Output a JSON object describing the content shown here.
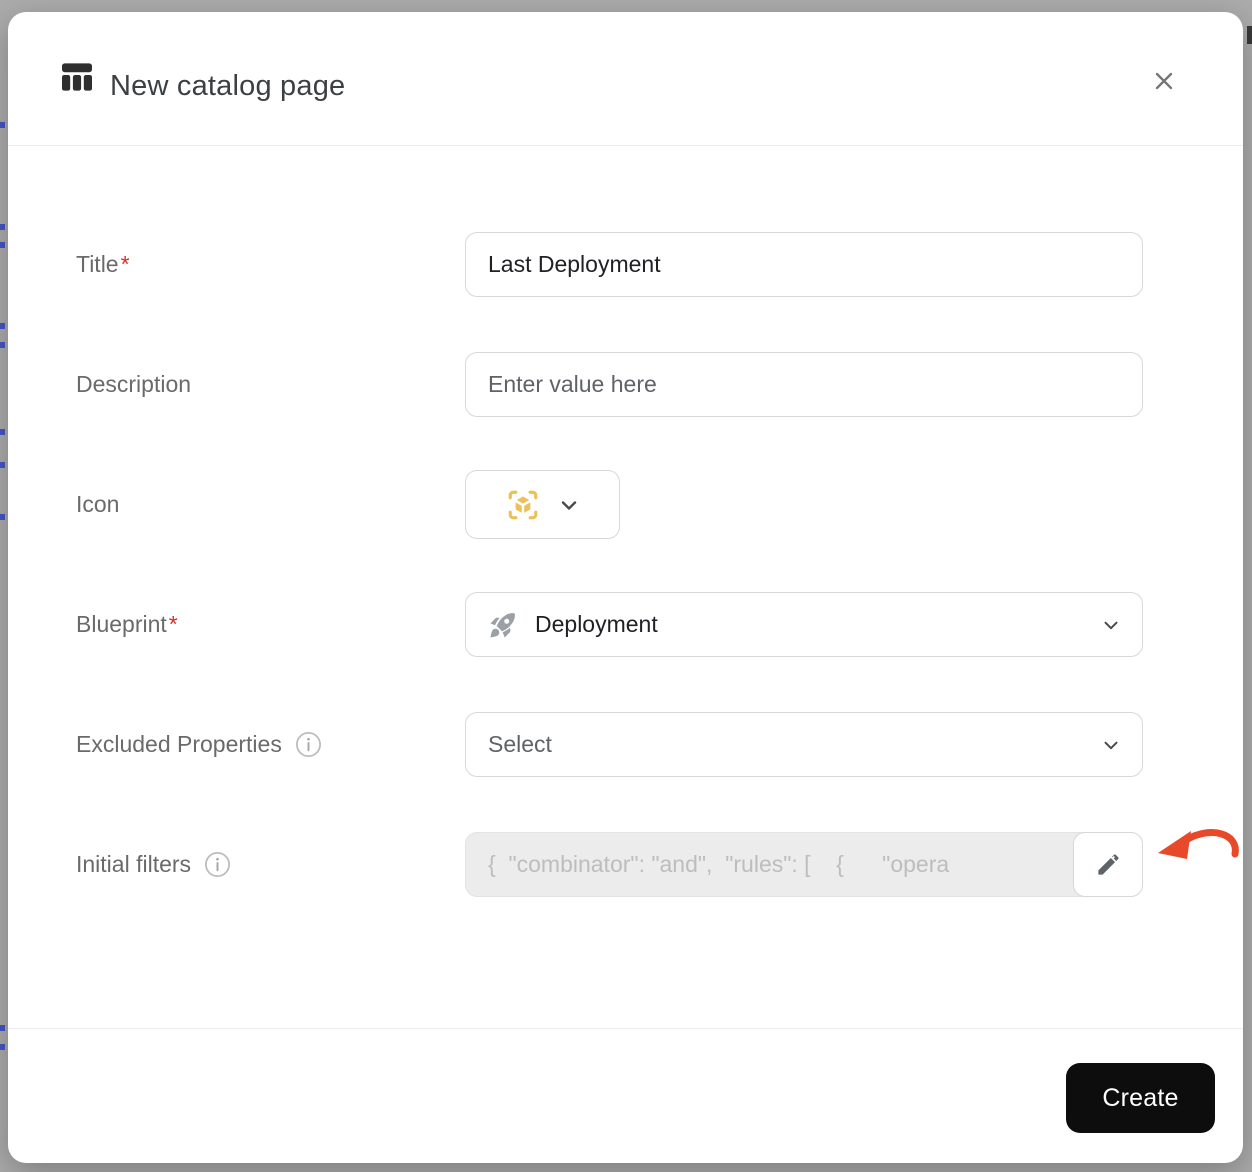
{
  "header": {
    "title": "New catalog page"
  },
  "form": {
    "title": {
      "label": "Title",
      "required_marker": "*",
      "value": "Last Deployment"
    },
    "description": {
      "label": "Description",
      "placeholder": "Enter value here"
    },
    "icon": {
      "label": "Icon",
      "selected_icon": "cube-scan-icon"
    },
    "blueprint": {
      "label": "Blueprint",
      "required_marker": "*",
      "selected": "Deployment",
      "selected_icon": "rocket-icon"
    },
    "excluded_properties": {
      "label": "Excluded Properties",
      "placeholder": "Select"
    },
    "initial_filters": {
      "label": "Initial filters",
      "value": "{  \"combinator\": \"and\",  \"rules\": [    {      \"opera"
    }
  },
  "footer": {
    "create_label": "Create"
  },
  "colors": {
    "icon_yellow": "#ECC055",
    "annotation_arrow_red": "#E8492B",
    "create_button_bg": "#0D0D0D",
    "required_red": "#D93025"
  }
}
